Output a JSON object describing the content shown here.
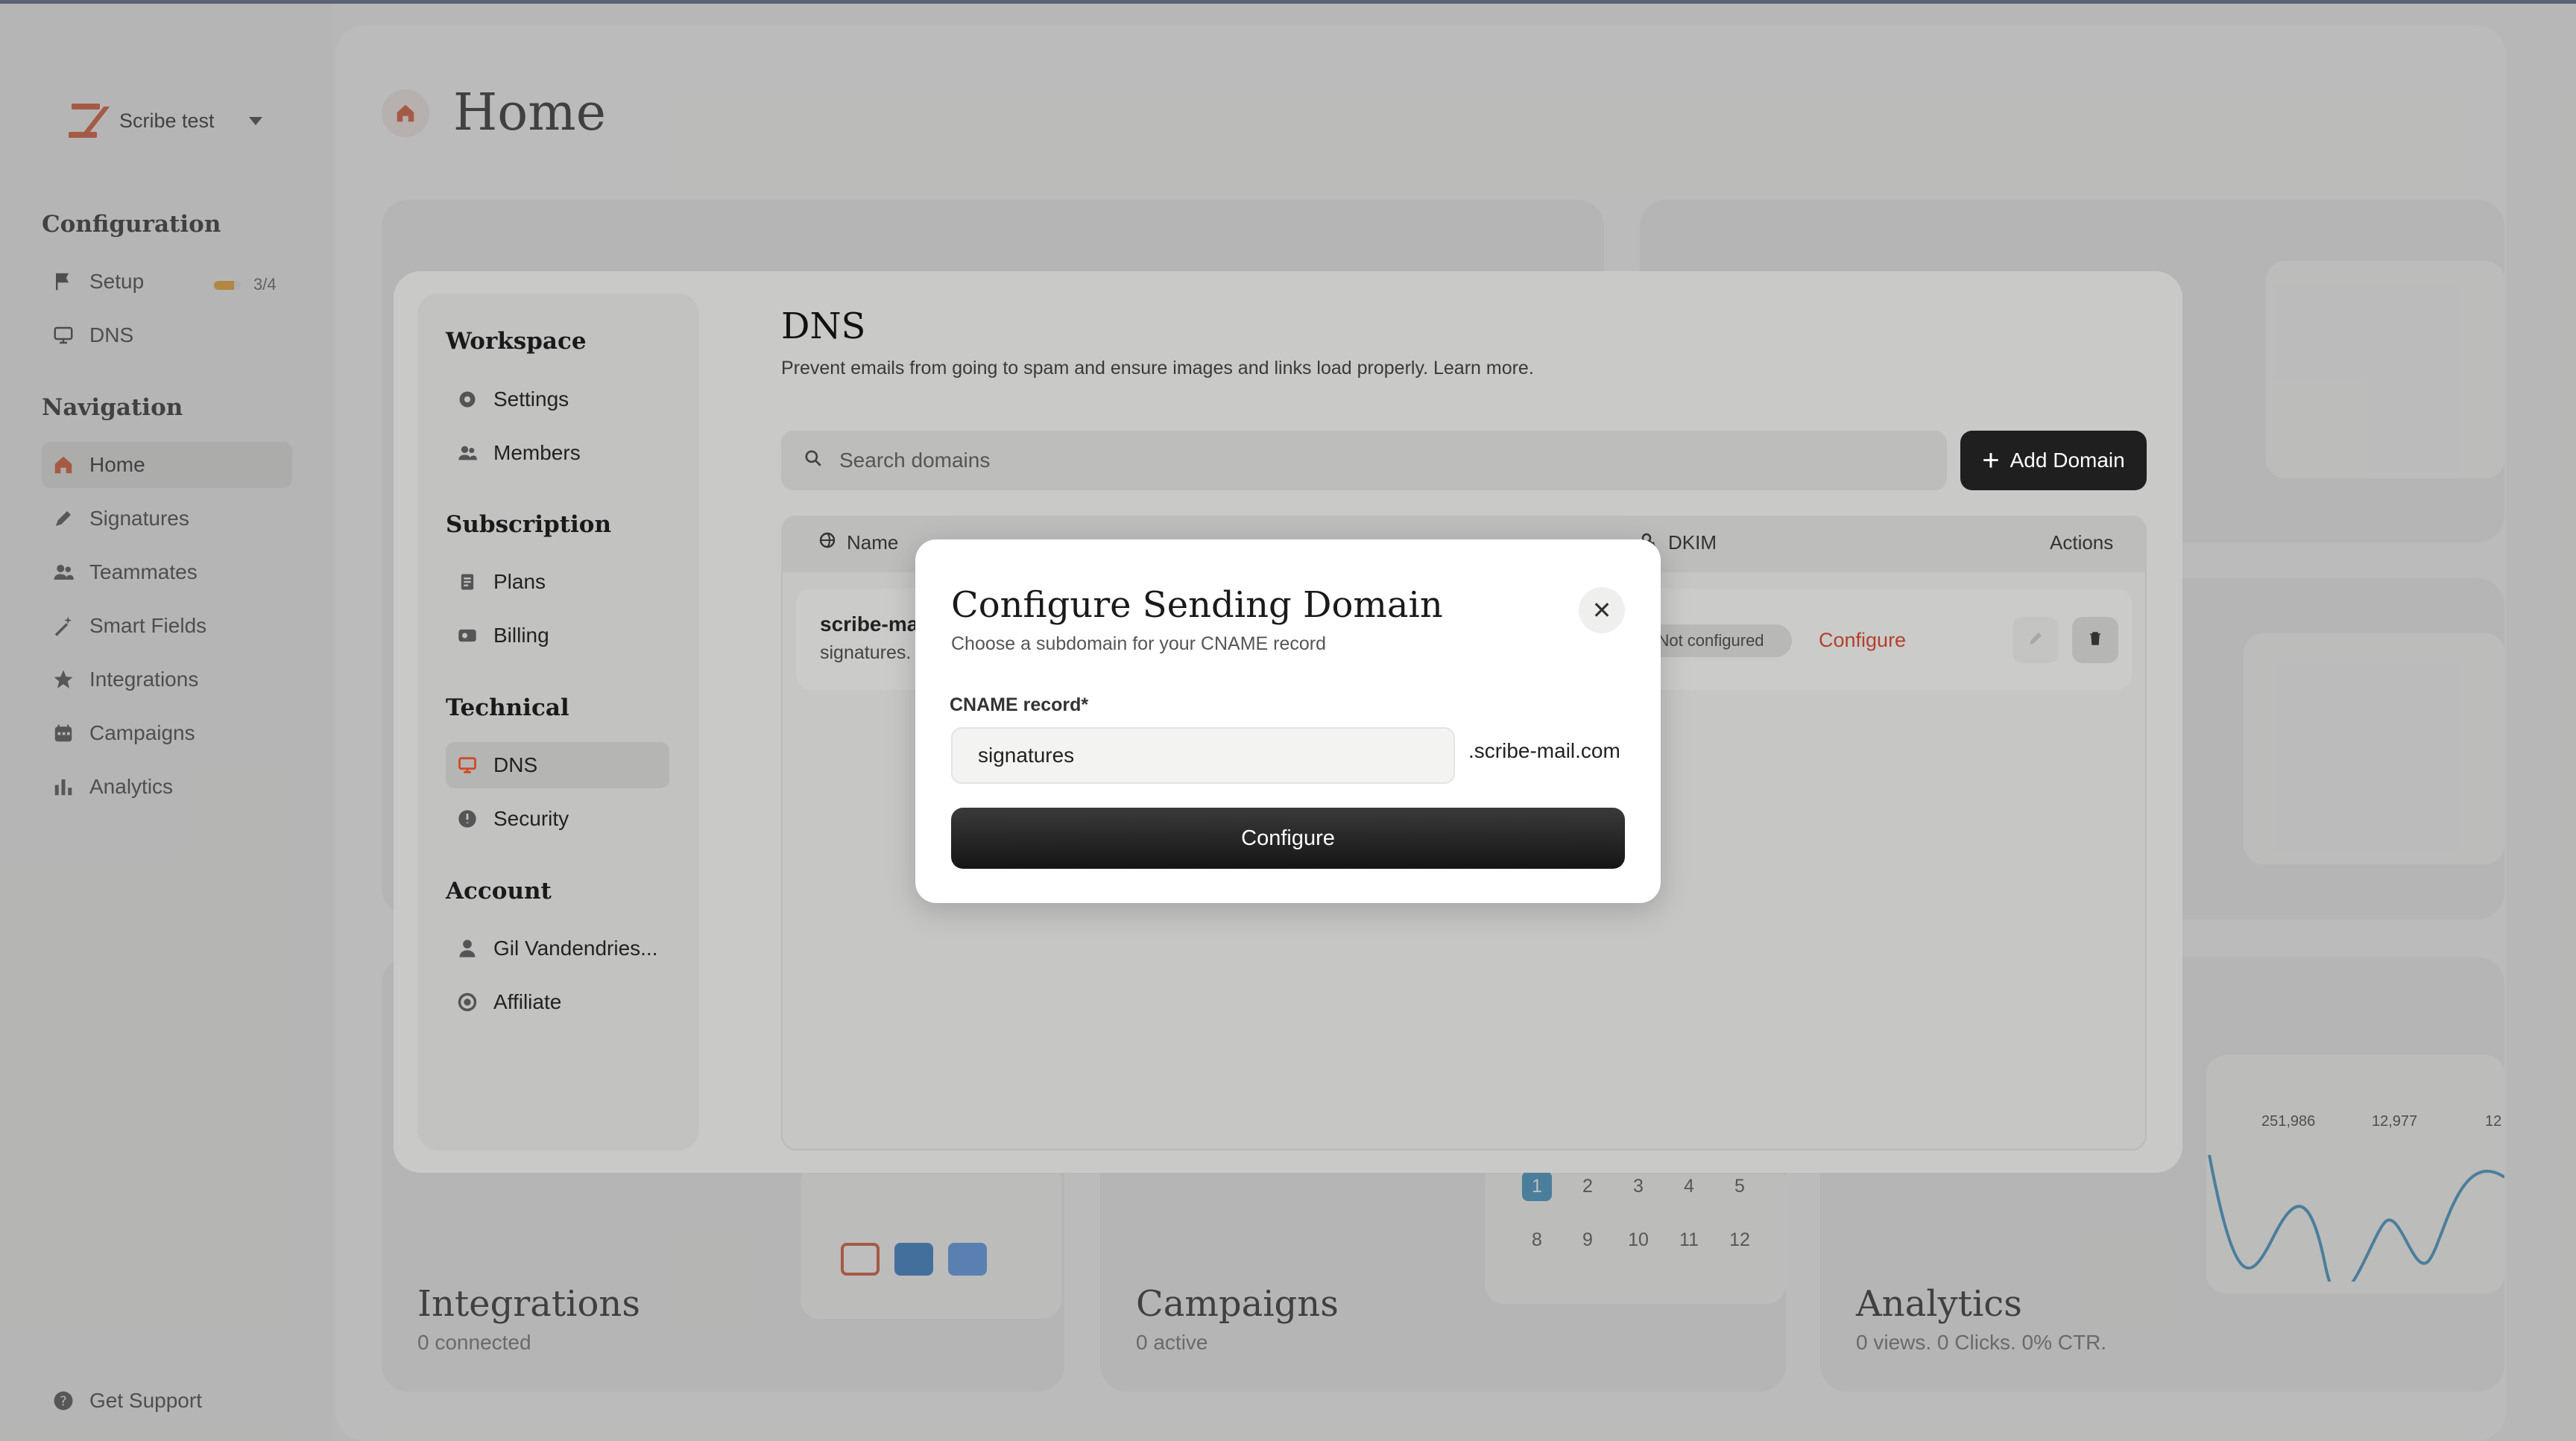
{
  "workspace": {
    "name": "Scribe test"
  },
  "sidebar": {
    "configuration_title": "Configuration",
    "setup_label": "Setup",
    "setup_progress_text": "3/4",
    "setup_progress_fraction": 0.75,
    "dns_label": "DNS",
    "navigation_title": "Navigation",
    "nav": [
      {
        "label": "Home",
        "icon": "home-icon"
      },
      {
        "label": "Signatures",
        "icon": "pen-icon"
      },
      {
        "label": "Teammates",
        "icon": "people-icon"
      },
      {
        "label": "Smart Fields",
        "icon": "wand-icon"
      },
      {
        "label": "Integrations",
        "icon": "star-icon"
      },
      {
        "label": "Campaigns",
        "icon": "calendar-icon"
      },
      {
        "label": "Analytics",
        "icon": "bar-chart-icon"
      }
    ],
    "support_label": "Get Support"
  },
  "home": {
    "title": "Home",
    "integrations": {
      "title": "Integrations",
      "sub": "0 connected"
    },
    "campaigns": {
      "title": "Campaigns",
      "sub": "0 active",
      "calendar": [
        "1",
        "2",
        "3",
        "4",
        "5",
        "8",
        "9",
        "10",
        "11",
        "12"
      ]
    },
    "analytics": {
      "title": "Analytics",
      "sub": "0 views. 0 Clicks. 0% CTR.",
      "stats": [
        "251,986",
        "12,977",
        "12"
      ]
    }
  },
  "settings": {
    "groups": {
      "workspace": "Workspace",
      "subscription": "Subscription",
      "technical": "Technical",
      "account": "Account"
    },
    "items": {
      "settings": "Settings",
      "members": "Members",
      "plans": "Plans",
      "billing": "Billing",
      "dns": "DNS",
      "security": "Security",
      "user": "Gil Vandendries...",
      "affiliate": "Affiliate"
    },
    "dns": {
      "title": "DNS",
      "description": "Prevent emails from going to spam and ensure images and links load properly. Learn more.",
      "search_placeholder": "Search domains",
      "add_domain": "Add Domain",
      "columns": {
        "name": "Name",
        "dkim": "DKIM",
        "actions": "Actions"
      },
      "row": {
        "name": "scribe-ma",
        "sub": "signatures.",
        "status": "Not configured",
        "action": "Configure"
      }
    }
  },
  "modal": {
    "title": "Configure Sending Domain",
    "subtitle": "Choose a subdomain for your CNAME record",
    "field_label": "CNAME record*",
    "field_value": "signatures",
    "suffix": ".scribe-mail.com",
    "button": "Configure"
  },
  "colors": {
    "accent": "#d24a24",
    "progress": "#e99b20",
    "primary_button": "#1f1f1f"
  }
}
